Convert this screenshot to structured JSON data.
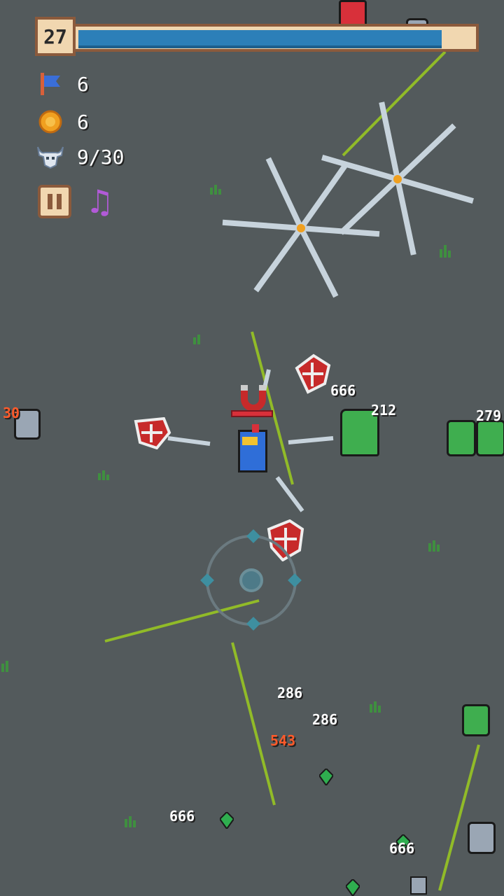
{
  "hud": {
    "level": "27",
    "xp_fraction": 0.92,
    "kills_flag": "6",
    "coins": "6",
    "wave": "9/30"
  },
  "colors": {
    "background": "#535a5c",
    "xp_fill": "#2c7fb8",
    "frame": "#8b5a3c",
    "panel": "#f1d7b0",
    "crit": "#ff5a2a",
    "laser": "#9ccc1f"
  },
  "icons": {
    "flag": "banner-flag-icon",
    "coin": "coin-icon",
    "skull": "bull-skull-icon",
    "pause": "pause-icon",
    "music": "music-note-icon"
  },
  "damage_numbers": [
    "666",
    "212",
    "279",
    "286",
    "286",
    "543",
    "666",
    "666",
    "30"
  ]
}
